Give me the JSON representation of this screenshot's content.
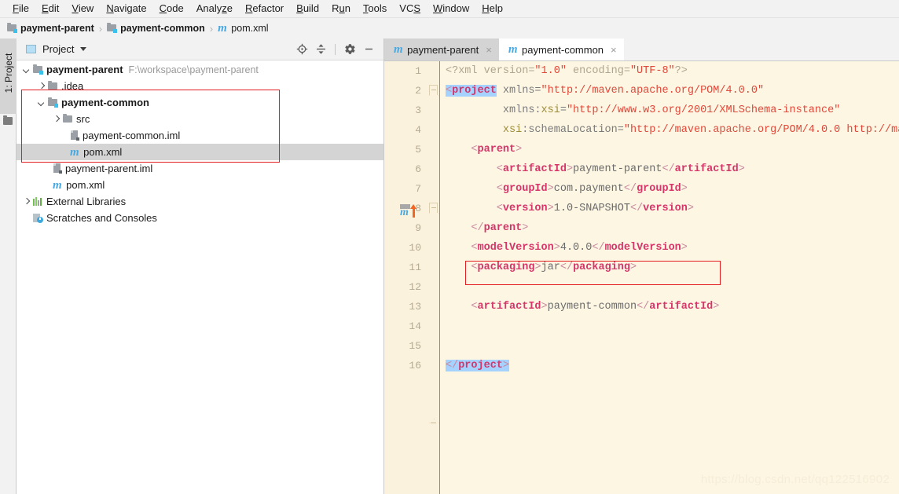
{
  "menu": {
    "items": [
      "File",
      "Edit",
      "View",
      "Navigate",
      "Code",
      "Analyze",
      "Refactor",
      "Build",
      "Run",
      "Tools",
      "VCS",
      "Window",
      "Help"
    ]
  },
  "breadcrumb": {
    "items": [
      {
        "label": "payment-parent",
        "icon": "module-icon",
        "bold": true
      },
      {
        "label": "payment-common",
        "icon": "module-icon",
        "bold": true
      },
      {
        "label": "pom.xml",
        "icon": "maven-icon",
        "bold": false
      }
    ],
    "separator": "›"
  },
  "left_strip": {
    "tool_window_tab": "1: Project",
    "tab_number": "1",
    "folder_icon": "folder-icon"
  },
  "project_panel": {
    "header": {
      "icon": "project-view-icon",
      "title": "Project",
      "dropdown_caret": "chevron-down-icon",
      "tools": [
        "locate-file-icon",
        "collapse-all-icon",
        "settings-gear-icon",
        "minimize-icon"
      ]
    },
    "tree": [
      {
        "indent": 0,
        "arrow": "down",
        "icon": "module-icon",
        "label": "payment-parent",
        "bold": true,
        "path": "F:\\workspace\\payment-parent",
        "selected": false
      },
      {
        "indent": 1,
        "arrow": "right",
        "icon": "folder-icon",
        "label": ".idea",
        "bold": false,
        "path": "",
        "selected": false
      },
      {
        "indent": 1,
        "arrow": "down",
        "icon": "module-icon",
        "label": "payment-common",
        "bold": true,
        "path": "",
        "selected": false
      },
      {
        "indent": 2,
        "arrow": "right",
        "icon": "folder-icon",
        "label": "src",
        "bold": false,
        "path": "",
        "selected": false
      },
      {
        "indent": 3,
        "arrow": "none",
        "icon": "iml-file-icon",
        "label": "payment-common.iml",
        "bold": false,
        "path": "",
        "selected": false
      },
      {
        "indent": 3,
        "arrow": "none",
        "icon": "maven-icon",
        "label": "pom.xml",
        "bold": false,
        "path": "",
        "selected": true
      },
      {
        "indent": 2,
        "arrow": "none",
        "icon": "iml-file-icon",
        "label": "payment-parent.iml",
        "bold": false,
        "path": "",
        "selected": false
      },
      {
        "indent": 2,
        "arrow": "none",
        "icon": "maven-icon",
        "label": "pom.xml",
        "bold": false,
        "path": "",
        "selected": false
      },
      {
        "indent": 0,
        "arrow": "right",
        "icon": "external-libraries-icon",
        "label": "External Libraries",
        "bold": false,
        "path": "",
        "selected": false
      },
      {
        "indent": 0,
        "arrow": "none",
        "icon": "scratches-icon",
        "label": "Scratches and Consoles",
        "bold": false,
        "path": "",
        "selected": false
      }
    ]
  },
  "editor": {
    "tabs": [
      {
        "label": "payment-parent",
        "icon": "maven-icon",
        "active": false,
        "close": "×"
      },
      {
        "label": "payment-common",
        "icon": "maven-icon",
        "active": true,
        "close": "×"
      }
    ],
    "line_numbers": [
      "1",
      "2",
      "3",
      "4",
      "5",
      "6",
      "7",
      "8",
      "9",
      "10",
      "11",
      "12",
      "13",
      "14",
      "15",
      "16"
    ],
    "gutter_marker": {
      "line": 5,
      "icon": "maven-update-icon"
    },
    "caret_line": 16,
    "code_lines": [
      {
        "n": 1,
        "text": "<?xml version=\"1.0\" encoding=\"UTF-8\"?>"
      },
      {
        "n": 2,
        "text": "<project xmlns=\"http://maven.apache.org/POM/4.0.0\""
      },
      {
        "n": 3,
        "text": "         xmlns:xsi=\"http://www.w3.org/2001/XMLSchema-instance\""
      },
      {
        "n": 4,
        "text": "         xsi:schemaLocation=\"http://maven.apache.org/POM/4.0.0 http://ma"
      },
      {
        "n": 5,
        "text": "    <parent>"
      },
      {
        "n": 6,
        "text": "        <artifactId>payment-parent</artifactId>"
      },
      {
        "n": 7,
        "text": "        <groupId>com.payment</groupId>"
      },
      {
        "n": 8,
        "text": "        <version>1.0-SNAPSHOT</version>"
      },
      {
        "n": 9,
        "text": "    </parent>"
      },
      {
        "n": 10,
        "text": "    <modelVersion>4.0.0</modelVersion>"
      },
      {
        "n": 11,
        "text": "    <packaging>jar</packaging>"
      },
      {
        "n": 12,
        "text": ""
      },
      {
        "n": 13,
        "text": "    <artifactId>payment-common</artifactId>"
      },
      {
        "n": 14,
        "text": ""
      },
      {
        "n": 15,
        "text": ""
      },
      {
        "n": 16,
        "text": "</project>"
      }
    ]
  },
  "annotations": {
    "tree_highlight_box_color": "#e31c22",
    "packaging_highlight_box_color": "#e31c22"
  },
  "watermark": {
    "text": "https://blog.csdn.net/qq122516902"
  },
  "colors": {
    "editor_bg": "#fdf6e3",
    "gutter_bg": "#fbf2de",
    "tag": "#d5366a",
    "string": "#e0483a",
    "attribute": "#9d8c3a",
    "selection": "#a6d2ff",
    "tree_selection": "#d4d4d4",
    "annotation_red": "#e31c22"
  }
}
